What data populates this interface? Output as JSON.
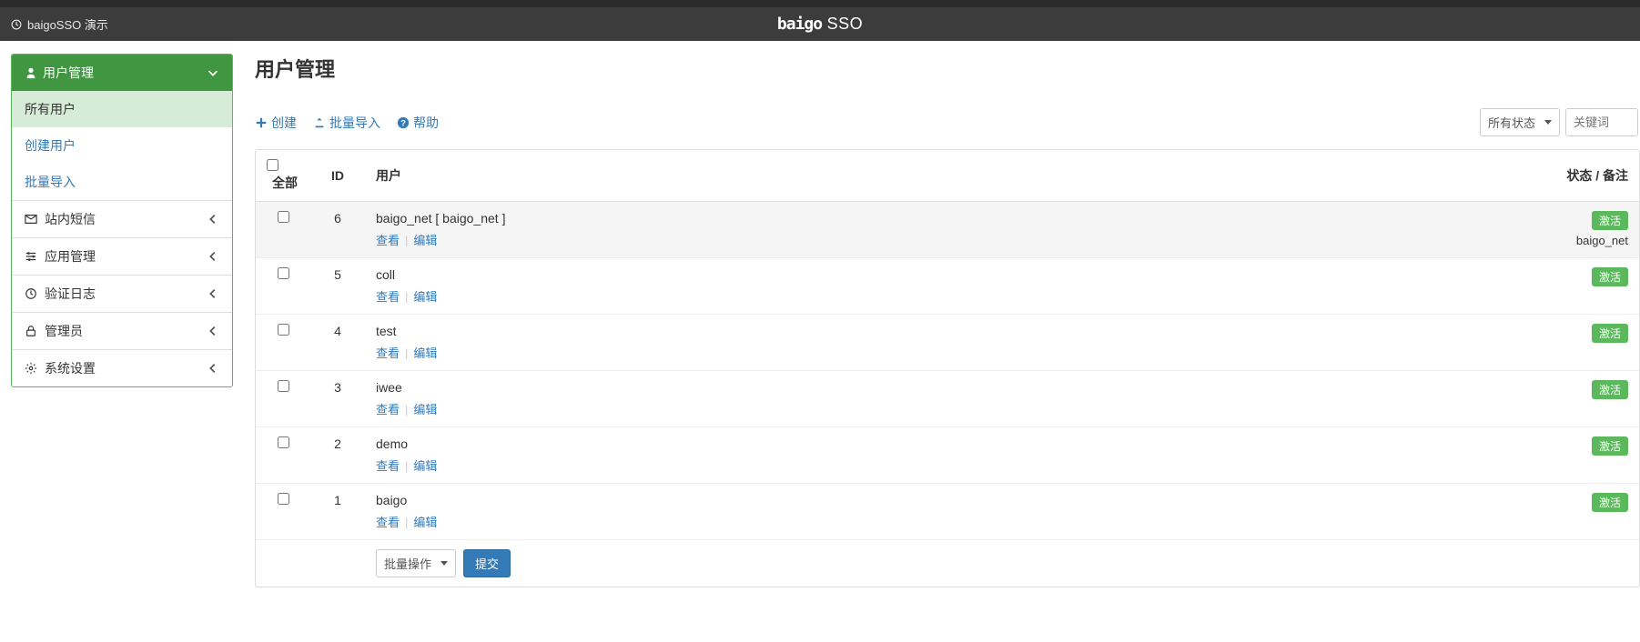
{
  "header": {
    "site_label": "baigoSSO 演示",
    "logo_text": "baigo",
    "product": "SSO"
  },
  "sidebar": {
    "main_label": "用户管理",
    "submenu": [
      {
        "label": "所有用户",
        "active": true
      },
      {
        "label": "创建用户"
      },
      {
        "label": "批量导入"
      }
    ],
    "items": [
      {
        "label": "站内短信"
      },
      {
        "label": "应用管理"
      },
      {
        "label": "验证日志"
      },
      {
        "label": "管理员"
      },
      {
        "label": "系统设置"
      }
    ]
  },
  "page": {
    "title": "用户管理"
  },
  "toolbar": {
    "create": "创建",
    "import": "批量导入",
    "help": "帮助",
    "status_filter": "所有状态",
    "search_placeholder": "关键词"
  },
  "table": {
    "header": {
      "all": "全部",
      "id": "ID",
      "user": "用户",
      "status": "状态 / 备注"
    },
    "rows": [
      {
        "id": "6",
        "user": "baigo_net [ baigo_net ]",
        "status": "激活",
        "note": "baigo_net",
        "hover": true
      },
      {
        "id": "5",
        "user": "coll",
        "status": "激活"
      },
      {
        "id": "4",
        "user": "test",
        "status": "激活"
      },
      {
        "id": "3",
        "user": "iwee",
        "status": "激活"
      },
      {
        "id": "2",
        "user": "demo",
        "status": "激活"
      },
      {
        "id": "1",
        "user": "baigo",
        "status": "激活"
      }
    ],
    "actions": {
      "view": "查看",
      "edit": "编辑"
    },
    "footer": {
      "bulk_label": "批量操作",
      "submit": "提交"
    }
  }
}
